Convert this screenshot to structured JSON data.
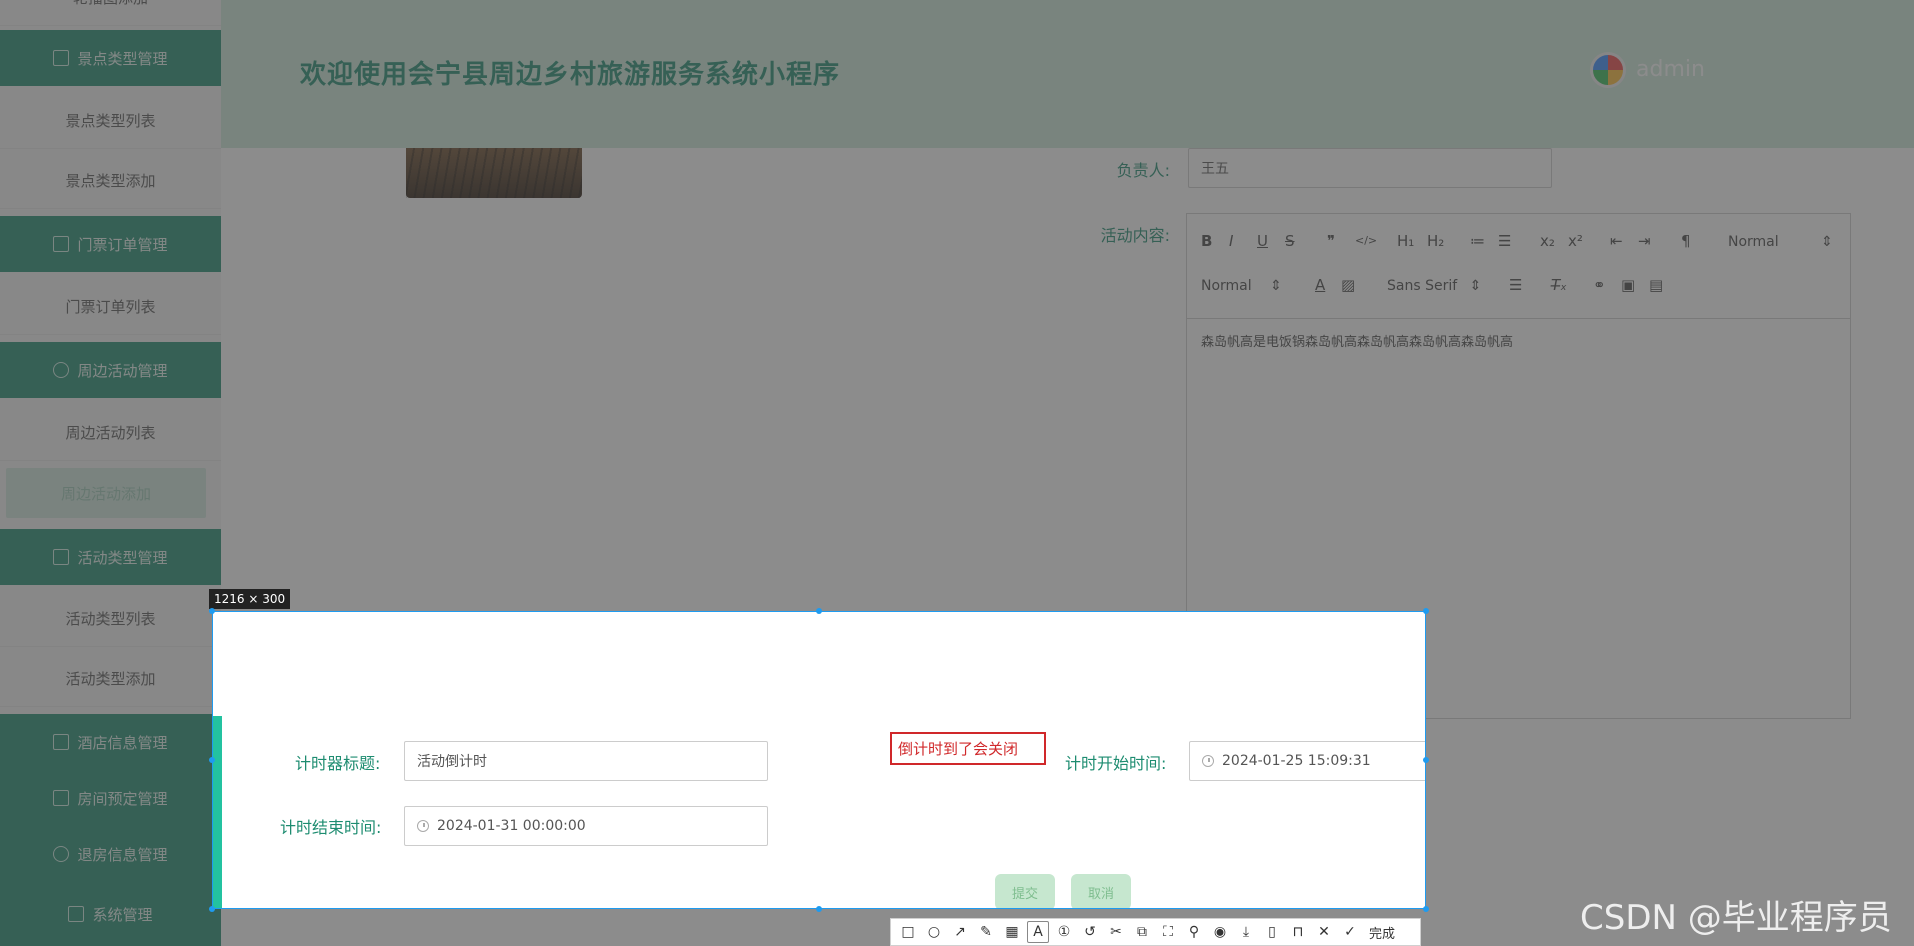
{
  "sidebar": {
    "top_partial": "轮播图添加",
    "groups": [
      {
        "label": "景点类型管理",
        "items": [
          "景点类型列表",
          "景点类型添加"
        ]
      },
      {
        "label": "门票订单管理",
        "items": [
          "门票订单列表"
        ]
      },
      {
        "label": "周边活动管理",
        "items": [
          "周边活动列表",
          "周边活动添加"
        ]
      },
      {
        "label": "活动类型管理",
        "items": [
          "活动类型列表",
          "活动类型添加"
        ]
      },
      {
        "label": "酒店信息管理",
        "items": []
      },
      {
        "label": "房间预定管理",
        "items": []
      },
      {
        "label": "退房信息管理",
        "items": []
      },
      {
        "label": "系统管理",
        "items": []
      }
    ]
  },
  "header": {
    "title": "欢迎使用会宁县周边乡村旅游服务系统小程序",
    "user": "admin"
  },
  "form": {
    "owner_label": "负责人:",
    "owner_value": "王五",
    "content_label": "活动内容:",
    "editor": {
      "toolbar_row1": [
        "B",
        "I",
        "U",
        "S",
        "❞",
        "</>",
        "H₁",
        "H₂",
        "≔",
        "☰",
        "x₂",
        "x²",
        "⇤",
        "⇥",
        "¶"
      ],
      "header_select": "Normal",
      "size_select": "Normal",
      "font_select": "Sans Serif",
      "body": "森岛帆高是电饭锅森岛帆高森岛帆高森岛帆高森岛帆高"
    }
  },
  "capture": {
    "size_badge": "1216 × 300",
    "timer_title_label": "计时器标题:",
    "timer_title_value": "活动倒计时",
    "timer_end_label": "计时结束时间:",
    "timer_end_value": "2024-01-31 00:00:00",
    "timer_start_label": "计时开始时间:",
    "timer_start_value": "2024-01-25 15:09:31",
    "annotation": "倒计时到了会关闭",
    "submit": "提交",
    "cancel": "取消",
    "done": "完成"
  },
  "watermark": "CSDN @毕业程序员"
}
